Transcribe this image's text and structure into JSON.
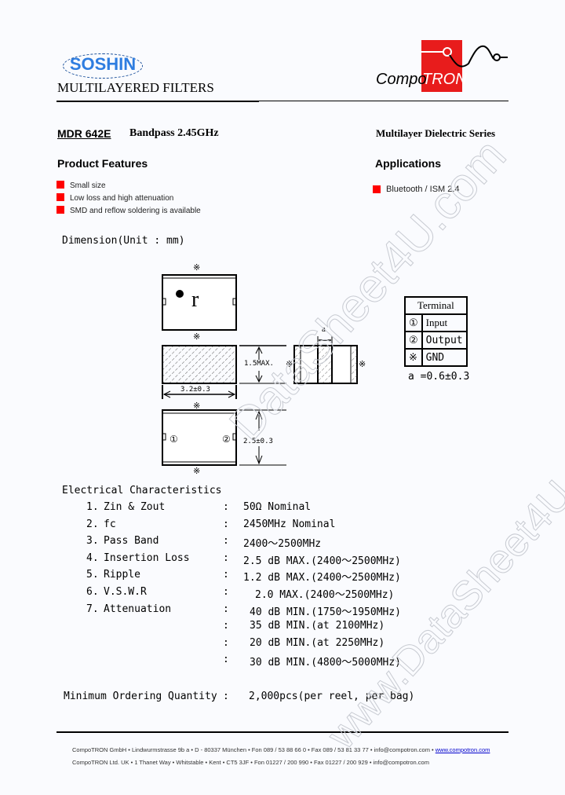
{
  "header": {
    "brand_left": "SOSHIN",
    "subtitle": "MULTILAYERED FILTERS",
    "brand_right_a": "Compo",
    "brand_right_b": "TRON",
    "brand_red": "#e81c1c",
    "brand_blue": "#2e7de0"
  },
  "product": {
    "model": "MDR 642E",
    "description": "Bandpass 2.45GHz",
    "series": "Multilayer Dielectric Series"
  },
  "features": {
    "heading": "Product Features",
    "items": [
      "Small size",
      "Low loss and high attenuation",
      "SMD and reflow soldering is available"
    ]
  },
  "applications": {
    "heading": "Applications",
    "items": [
      "Bluetooth / ISM 2.4"
    ]
  },
  "dimension": {
    "title": "Dimension(Unit : mm)",
    "gnd_mark": "※",
    "marking_letter": "r",
    "height_label": "1.5MAX.",
    "length_label": "3.2±0.3",
    "width_label": "2.5±0.3",
    "pin1": "①",
    "pin2": "②",
    "a_label": "a",
    "a_value": "a =0.6±0.3",
    "terminal": {
      "header": "Terminal",
      "rows": [
        {
          "symbol": "①",
          "name": "Input"
        },
        {
          "symbol": "②",
          "name": "Output"
        },
        {
          "symbol": "※",
          "name": "GND"
        }
      ]
    }
  },
  "electrical": {
    "title": "Electrical Characteristics",
    "rows": [
      {
        "num": "1.",
        "label": "Zin & Zout",
        "value": "50Ω Nominal"
      },
      {
        "num": "2.",
        "label": "fc",
        "value": "2450MHz Nominal"
      },
      {
        "num": "3.",
        "label": "Pass Band",
        "value": "2400～2500MHz"
      },
      {
        "num": "4.",
        "label": "Insertion Loss",
        "value": "2.5 dB MAX.(2400～2500MHz)"
      },
      {
        "num": "5.",
        "label": "Ripple",
        "value": "1.2 dB MAX.(2400～2500MHz)"
      },
      {
        "num": "6.",
        "label": "V.S.W.R",
        "value": "2.0 MAX.(2400～2500MHz)"
      },
      {
        "num": "7.",
        "label": "Attenuation",
        "value": "40 dB MIN.(1750～1950MHz)"
      },
      {
        "num": "",
        "label": "",
        "value": "35 dB MIN.(at 2100MHz)"
      },
      {
        "num": "",
        "label": "",
        "value": "20 dB MIN.(at 2250MHz)"
      },
      {
        "num": "",
        "label": "",
        "value": "30 dB MIN.(4800～5000MHz)"
      }
    ],
    "colon": ":"
  },
  "moq": {
    "label": "Minimum Ordering Quantity",
    "colon": ":",
    "value": "2,000pcs(per reel, per bag)"
  },
  "footer": {
    "line1": "CompoTRON GmbH • Lindwurmstrasse 9b a • D - 80337 München • Fon 089 / 53 88 66 0 • Fax 089 / 53 81 33 77 • info@compotron.com • ",
    "line1_link": "www.compotron.com",
    "line2": "CompoTRON Ltd. UK • 1 Thanet Way • Whitstable • Kent • CT5 3JF • Fon 01227 / 200 990 • Fax 01227 / 200 929 • info@compotron.com"
  },
  "watermark": {
    "text_a": "DataSheet4U.com",
    "text_b": "www.DataSheet4U.com"
  }
}
